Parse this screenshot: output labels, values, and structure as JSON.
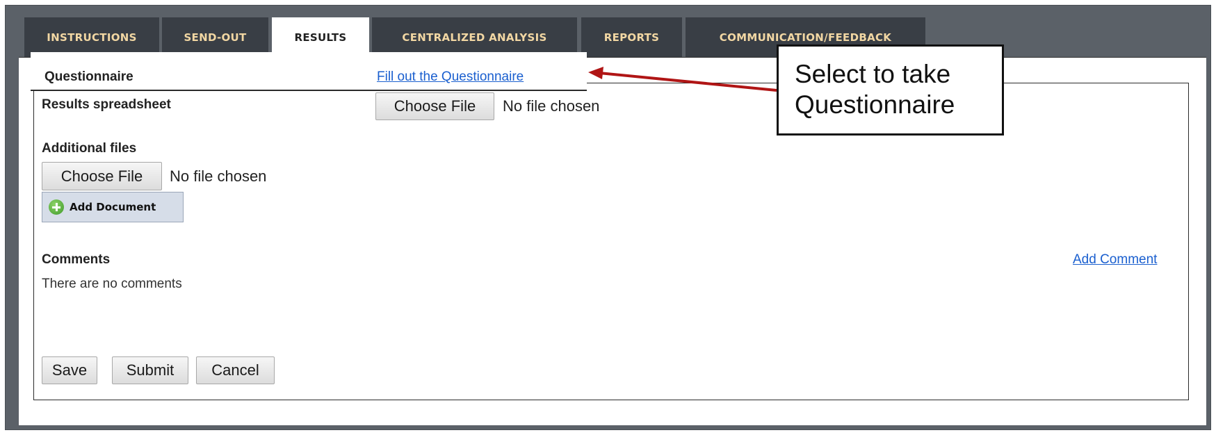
{
  "tabs": [
    {
      "label": "INSTRUCTIONS",
      "active": false
    },
    {
      "label": "SEND-OUT",
      "active": false
    },
    {
      "label": "RESULTS",
      "active": true
    },
    {
      "label": "CENTRALIZED ANALYSIS",
      "active": false
    },
    {
      "label": "REPORTS",
      "active": false
    },
    {
      "label": "COMMUNICATION/FEEDBACK",
      "active": false
    }
  ],
  "questionnaire": {
    "label": "Questionnaire",
    "link": "Fill out the Questionnaire"
  },
  "results_spreadsheet": {
    "label": "Results spreadsheet",
    "button": "Choose File",
    "status": "No file chosen"
  },
  "additional_files": {
    "label": "Additional files",
    "button": "Choose File",
    "status": "No file chosen",
    "add_document": "Add Document"
  },
  "comments": {
    "label": "Comments",
    "empty_text": "There are no comments",
    "add_link": "Add Comment"
  },
  "actions": {
    "save": "Save",
    "submit": "Submit",
    "cancel": "Cancel"
  },
  "callout": {
    "line1": "Select to take",
    "line2": "Questionnaire"
  },
  "colors": {
    "tab_bg": "#393e45",
    "tab_text": "#f2d7a3",
    "frame_bg": "#5b6168",
    "link": "#1a5fcf",
    "arrow": "#b01515"
  },
  "icons": {
    "add_document": "plus-circle-icon"
  }
}
